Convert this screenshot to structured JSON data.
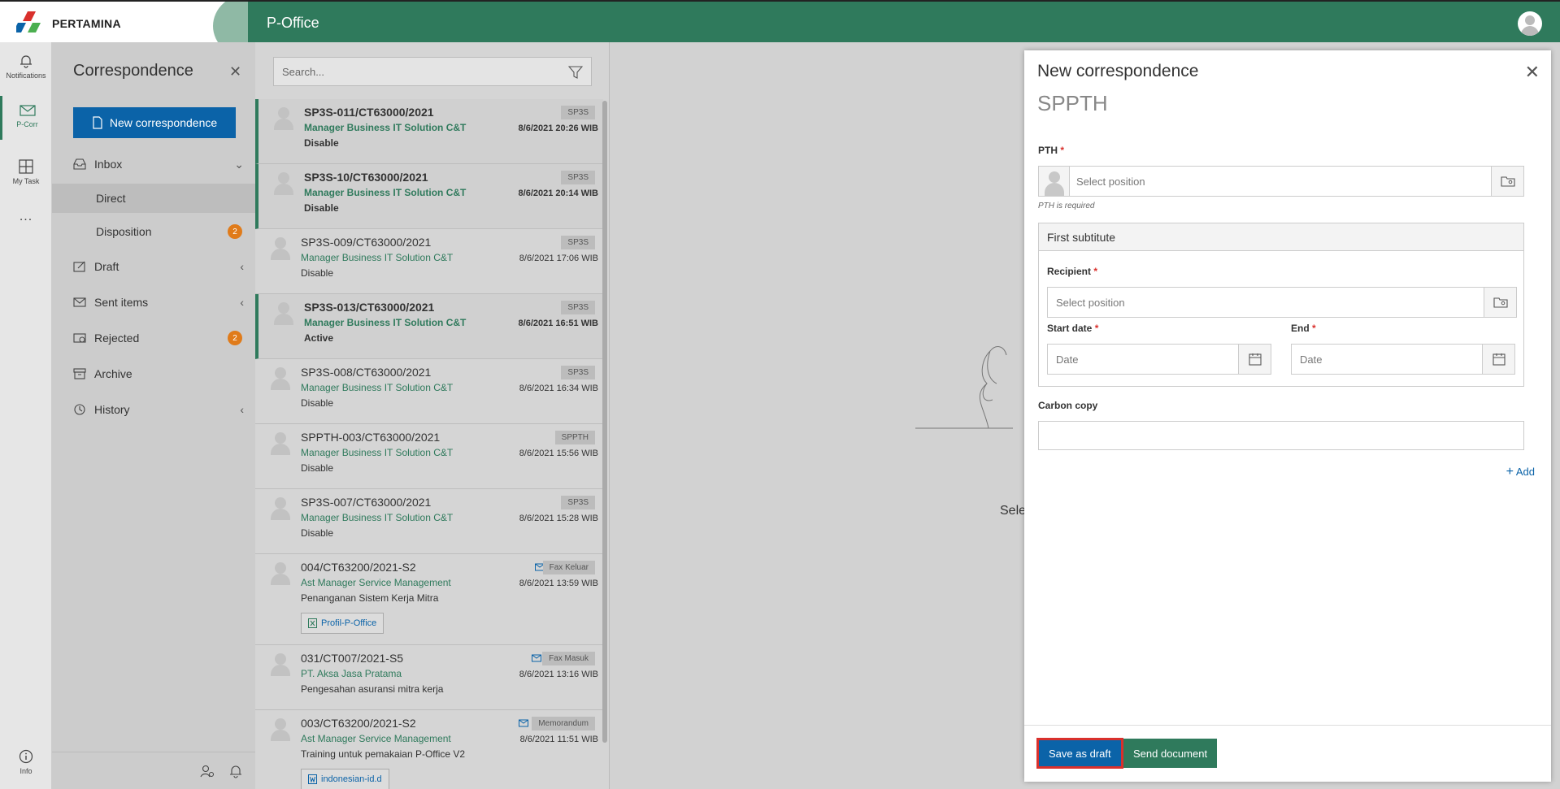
{
  "header": {
    "logo_text": "PERTAMINA",
    "app_title": "P-Office"
  },
  "rail": {
    "notifications": "Notifications",
    "pcorr": "P-Corr",
    "mytask": "My Task",
    "more": "...",
    "info": "Info"
  },
  "nav": {
    "title": "Correspondence",
    "new_button": "New correspondence",
    "inbox": "Inbox",
    "direct": "Direct",
    "disposition": "Disposition",
    "disposition_count": "2",
    "draft": "Draft",
    "sent": "Sent items",
    "rejected": "Rejected",
    "rejected_count": "2",
    "archive": "Archive",
    "history": "History"
  },
  "list": {
    "search_placeholder": "Search...",
    "rows": [
      {
        "number": "SP3S-011/CT63000/2021",
        "sender": "Manager Business IT Solution C&T",
        "subject": "Disable",
        "tag": "SP3S",
        "date": "8/6/2021 20:26 WIB"
      },
      {
        "number": "SP3S-10/CT63000/2021",
        "sender": "Manager Business IT Solution C&T",
        "subject": "Disable",
        "tag": "SP3S",
        "date": "8/6/2021 20:14 WIB"
      },
      {
        "number": "SP3S-009/CT63000/2021",
        "sender": "Manager Business IT Solution C&T",
        "subject": "Disable",
        "tag": "SP3S",
        "date": "8/6/2021 17:06 WIB"
      },
      {
        "number": "SP3S-013/CT63000/2021",
        "sender": "Manager Business IT Solution C&T",
        "subject": "Active",
        "tag": "SP3S",
        "date": "8/6/2021 16:51 WIB"
      },
      {
        "number": "SP3S-008/CT63000/2021",
        "sender": "Manager Business IT Solution C&T",
        "subject": "Disable",
        "tag": "SP3S",
        "date": "8/6/2021 16:34 WIB"
      },
      {
        "number": "SPPTH-003/CT63000/2021",
        "sender": "Manager Business IT Solution C&T",
        "subject": "Disable",
        "tag": "SPPTH",
        "date": "8/6/2021 15:56 WIB"
      },
      {
        "number": "SP3S-007/CT63000/2021",
        "sender": "Manager Business IT Solution C&T",
        "subject": "Disable",
        "tag": "SP3S",
        "date": "8/6/2021 15:28 WIB"
      },
      {
        "number": "004/CT63200/2021-S2",
        "sender": "Ast Manager Service Management",
        "subject": "Penanganan Sistem Kerja Mitra",
        "tag": "Fax Keluar",
        "date": "8/6/2021 13:59 WIB",
        "attachment": "Profil-P-Office"
      },
      {
        "number": "031/CT007/2021-S5",
        "sender": "PT. Aksa Jasa Pratama",
        "subject": "Pengesahan asuransi mitra kerja",
        "tag": "Fax Masuk",
        "date": "8/6/2021 13:16 WIB"
      },
      {
        "number": "003/CT63200/2021-S2",
        "sender": "Ast Manager Service Management",
        "subject": "Training untuk pemakaian P-Office V2",
        "tag": "Memorandum",
        "date": "8/6/2021 11:51 WIB",
        "attachment": "indonesian-id.d"
      }
    ]
  },
  "empty": {
    "text": "Sele"
  },
  "dialog": {
    "title": "New correspondence",
    "subtitle": "SPPTH",
    "pth_label": "PTH",
    "required_mark": "*",
    "pth_placeholder": "Select position",
    "pth_hint": "PTH is required",
    "first_subtitute": "First subtitute",
    "recipient_label": "Recipient",
    "recipient_placeholder": "Select position",
    "start_label": "Start date",
    "end_label": "End",
    "date_placeholder": "Date",
    "cc_label": "Carbon copy",
    "add_label": "Add",
    "save_draft": "Save as draft",
    "send_document": "Send document"
  },
  "colors": {
    "brand_green": "#2f7a5c",
    "primary_blue": "#0b63a8",
    "badge_orange": "#e07b1a",
    "required_red": "#d9302c"
  }
}
